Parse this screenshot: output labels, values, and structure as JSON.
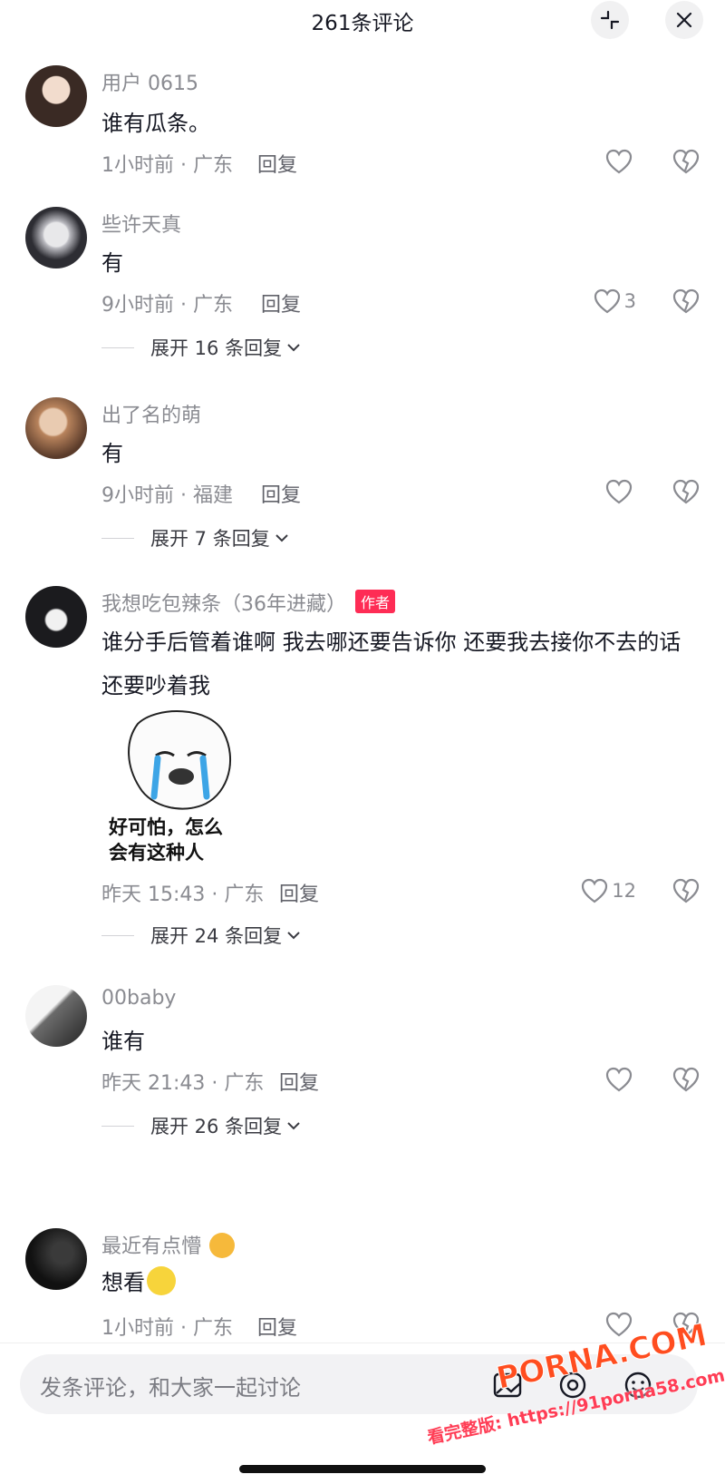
{
  "header": {
    "title": "261条评论"
  },
  "comments": [
    {
      "user": "用户 0615",
      "text": "谁有瓜条。",
      "meta": "1小时前 · 广东",
      "reply": "回复",
      "likes": "",
      "expand": ""
    },
    {
      "user": "些许天真",
      "text": "有",
      "meta": "9小时前 · 广东",
      "reply": "回复",
      "likes": "3",
      "expand": "展开 16 条回复"
    },
    {
      "user": "出了名的萌",
      "text": "有",
      "meta": "9小时前 · 福建",
      "reply": "回复",
      "likes": "",
      "expand": "展开 7 条回复"
    },
    {
      "user": "我想吃包辣条（36年进藏）",
      "author_tag": "作者",
      "text": "谁分手后管着谁啊 我去哪还要告诉你 还要我去接你不去的话还要吵着我",
      "sticker_text": "好可怕，怎么\n会有这种人",
      "meta": "昨天 15:43 · 广东",
      "reply": "回复",
      "likes": "12",
      "expand": "展开 24 条回复"
    },
    {
      "user": "00baby",
      "text": "谁有",
      "meta": "昨天 21:43 · 广东",
      "reply": "回复",
      "likes": "",
      "expand": "展开 26 条回复"
    },
    {
      "user": "最近有点懵",
      "text": "想看",
      "meta": "1小时前 · 广东",
      "reply": "回复",
      "likes": "",
      "expand": ""
    }
  ],
  "input": {
    "placeholder": "发条评论，和大家一起讨论"
  },
  "watermark": {
    "brand": "PORNA.COM",
    "url": "看完整版: https://91porna58.com"
  },
  "colors": {
    "accent": "#fe2c55",
    "muted": "#8a8b91",
    "text": "#161823"
  }
}
